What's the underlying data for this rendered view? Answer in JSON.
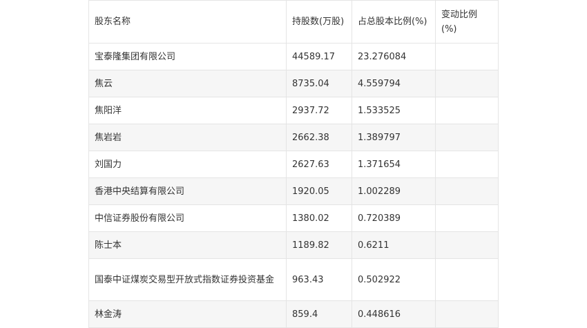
{
  "table": {
    "headers": [
      "股东名称",
      "持股数(万股)",
      "占总股本比例(%)",
      "变动比例(%)"
    ],
    "rows": [
      [
        "宝泰隆集团有限公司",
        "44589.17",
        "23.276084",
        ""
      ],
      [
        "焦云",
        "8735.04",
        "4.559794",
        ""
      ],
      [
        "焦阳洋",
        "2937.72",
        "1.533525",
        ""
      ],
      [
        "焦岩岩",
        "2662.38",
        "1.389797",
        ""
      ],
      [
        "刘国力",
        "2627.63",
        "1.371654",
        ""
      ],
      [
        "香港中央结算有限公司",
        "1920.05",
        "1.002289",
        ""
      ],
      [
        "中信证券股份有限公司",
        "1380.02",
        "0.720389",
        ""
      ],
      [
        "陈士本",
        "1189.82",
        "0.6211",
        ""
      ],
      [
        "国泰中证煤炭交易型开放式指数证券投资基金",
        "963.43",
        "0.502922",
        ""
      ],
      [
        "林金涛",
        "859.4",
        "0.448616",
        ""
      ]
    ]
  }
}
